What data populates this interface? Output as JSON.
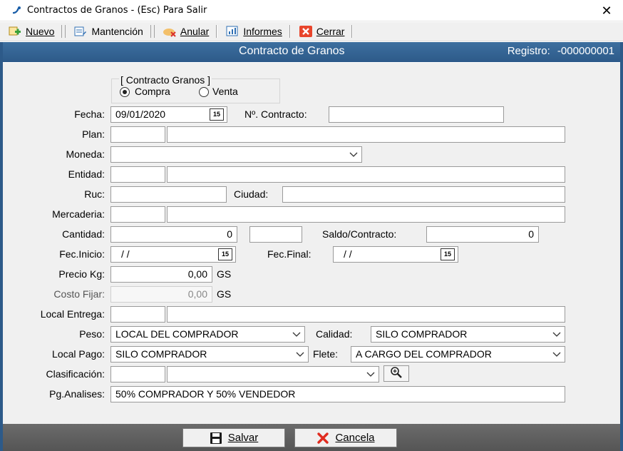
{
  "window": {
    "title": "Contractos de Granos -  (Esc) Para Salir",
    "close_glyph": "✕"
  },
  "toolbar": {
    "nuevo": "Nuevo",
    "mantencion": "Mantención",
    "anular": "Anular",
    "informes": "Informes",
    "cerrar": "Cerrar"
  },
  "header": {
    "title": "Contracto de Granos",
    "registro_label": "Registro:",
    "registro_value": "-000000001"
  },
  "form": {
    "group_title": "[ Contracto Granos ]",
    "radio_compra": "Compra",
    "radio_venta": "Venta",
    "selected": "Compra",
    "fecha_label": "Fecha:",
    "fecha_value": "09/01/2020",
    "contracto_label": "Nº. Contracto:",
    "contracto_value": "",
    "plan_label": "Plan:",
    "moneda_label": "Moneda:",
    "moneda_value": "",
    "entidad_label": "Entidad:",
    "ruc_label": "Ruc:",
    "ciudad_label": "Ciudad:",
    "mercaderia_label": "Mercaderia:",
    "cantidad_label": "Cantidad:",
    "cantidad_value": "0",
    "saldo_label": "Saldo/Contracto:",
    "saldo_value": "0",
    "fec_inicio_label": "Fec.Inicio:",
    "fec_inicio_value": "/ /",
    "fec_final_label": "Fec.Final:",
    "fec_final_value": "/ /",
    "precio_label": "Precio Kg:",
    "precio_value": "0,00",
    "precio_unit": "GS",
    "costo_label": "Costo Fijar:",
    "costo_value": "0,00",
    "costo_unit": "GS",
    "local_entrega_label": "Local Entrega:",
    "peso_label": "Peso:",
    "peso_value": "LOCAL DEL COMPRADOR",
    "calidad_label": "Calidad:",
    "calidad_value": "SILO COMPRADOR",
    "local_pago_label": "Local Pago:",
    "local_pago_value": "SILO COMPRADOR",
    "flete_label": "Flete:",
    "flete_value": "A CARGO DEL COMPRADOR",
    "clasificacion_label": "Clasificación:",
    "pg_analises_label": "Pg.Analises:",
    "pg_analises_value": "50% COMPRADOR Y 50% VENDEDOR",
    "calendar_glyph": "15"
  },
  "buttons": {
    "salvar": "Salvar",
    "cancela": "Cancela"
  },
  "colors": {
    "header_band": "#2d5a89",
    "bottom_bar": "#5e5e5e",
    "cerrar_icon": "#e8452c"
  }
}
